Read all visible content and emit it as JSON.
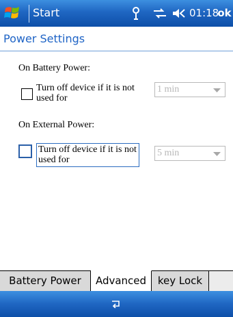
{
  "titlebar": {
    "start_label": "Start",
    "clock": "01:18",
    "ok_label": "ok",
    "icons": [
      "windows-flag-icon",
      "connectivity-icon",
      "signal-icon",
      "speaker-icon"
    ]
  },
  "page": {
    "title": "Power Settings"
  },
  "battery": {
    "section_label": "On Battery Power:",
    "checkbox_label": "Turn off device if it is not used for",
    "checked": false,
    "combo_value": "1 min"
  },
  "external": {
    "section_label": "On External Power:",
    "checkbox_label": "Turn off device if it is not used for",
    "checked": false,
    "combo_value": "5 min"
  },
  "tabs": [
    {
      "label": "Battery Power",
      "active": false
    },
    {
      "label": "Advanced",
      "active": true
    },
    {
      "label": "key Lock",
      "active": false
    }
  ],
  "bottombar": {
    "icons": [
      "input-panel-icon"
    ]
  },
  "colors": {
    "titlebar": "#1f66c2",
    "page_title": "#1f64c6",
    "focus": "#2a6cc0",
    "disabled_text": "#b7b7b7"
  }
}
